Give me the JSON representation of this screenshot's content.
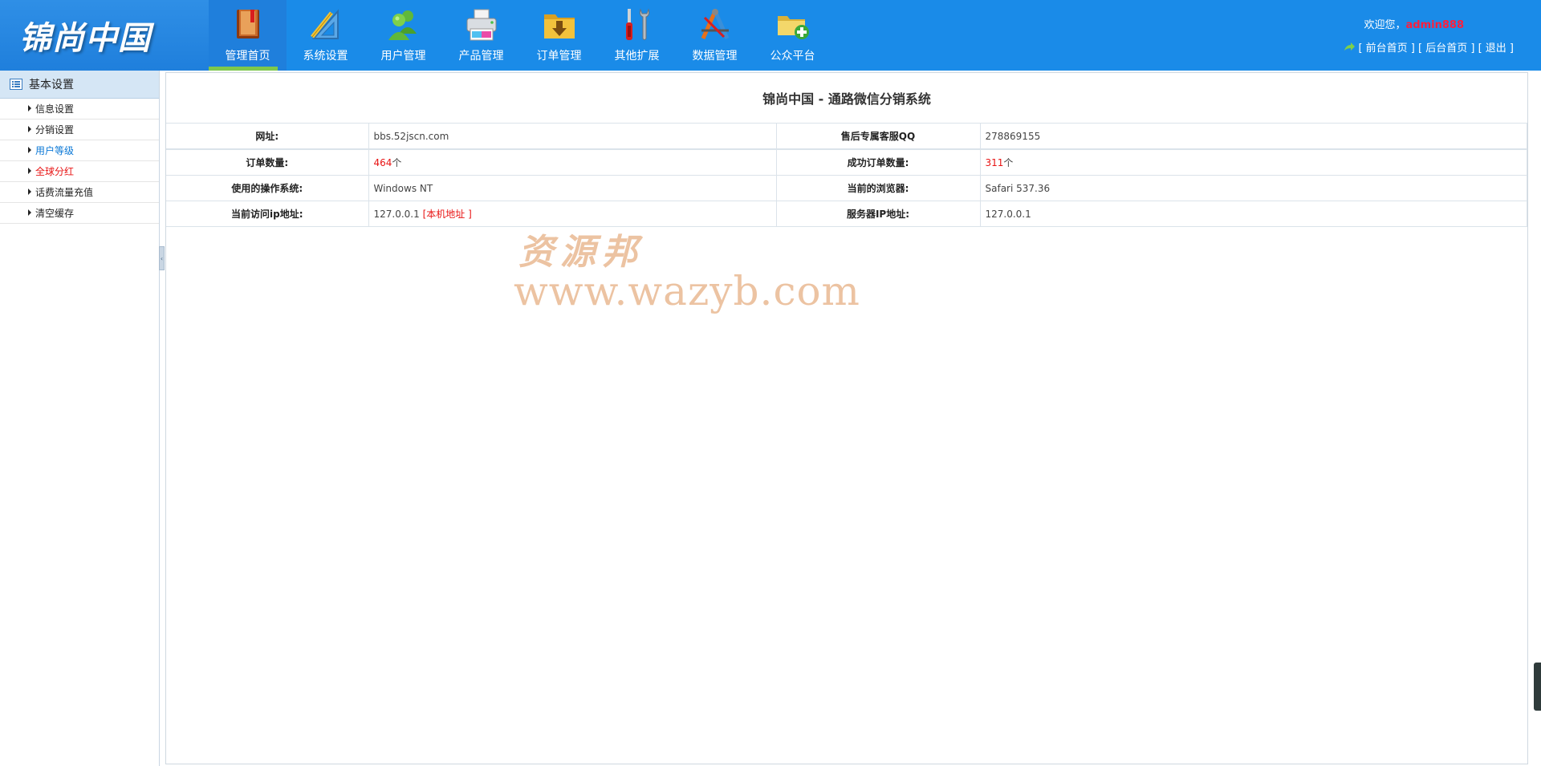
{
  "app": {
    "logo_text": "锦尚中国"
  },
  "nav": [
    {
      "label": "管理首页",
      "icon": "book-icon",
      "active": true
    },
    {
      "label": "系统设置",
      "icon": "ruler-icon",
      "active": false
    },
    {
      "label": "用户管理",
      "icon": "users-icon",
      "active": false
    },
    {
      "label": "产品管理",
      "icon": "printer-icon",
      "active": false
    },
    {
      "label": "订单管理",
      "icon": "folder-download-icon",
      "active": false
    },
    {
      "label": "其他扩展",
      "icon": "tools-icon",
      "active": false
    },
    {
      "label": "数据管理",
      "icon": "compass-icon",
      "active": false
    },
    {
      "label": "公众平台",
      "icon": "folder-add-icon",
      "active": false
    }
  ],
  "user": {
    "welcome": "欢迎您，",
    "name": "admin888",
    "links": {
      "front_home": "[ 前台首页 ]",
      "back_home": "[ 后台首页 ]",
      "logout": "[ 退出 ]"
    }
  },
  "sidebar": {
    "title": "基本设置",
    "items": [
      {
        "label": "信息设置"
      },
      {
        "label": "分销设置"
      },
      {
        "label": "用户等级"
      },
      {
        "label": "全球分红"
      },
      {
        "label": "话费流量充值"
      },
      {
        "label": "清空缓存"
      }
    ]
  },
  "main": {
    "title": "锦尚中国 - 通路微信分销系统",
    "rows": [
      {
        "l1": "网址:",
        "v1": "bbs.52jscn.com",
        "l2": "售后专属客服QQ",
        "v2": "278869155"
      },
      {
        "l1": "订单数量:",
        "v1_num": "464",
        "v1_unit": "个",
        "l2": "成功订单数量:",
        "v2_num": "311",
        "v2_unit": "个"
      },
      {
        "l1": "使用的操作系统:",
        "v1": "Windows NT",
        "l2": "当前的浏览器:",
        "v2": "Safari 537.36"
      },
      {
        "l1": "当前访问ip地址:",
        "v1_ip": "127.0.0.1",
        "v1_open": " [",
        "v1_link": "本机地址",
        "v1_close": " ]",
        "l2": "服务器IP地址:",
        "v2": "127.0.0.1"
      }
    ]
  },
  "watermark": {
    "cn": "资源邦",
    "url": "www.wazyb.com"
  },
  "colors": {
    "header": "#1a8be8",
    "accent_green": "#7ec84c",
    "red": "#e81414",
    "blue_link": "#0b78d6"
  }
}
